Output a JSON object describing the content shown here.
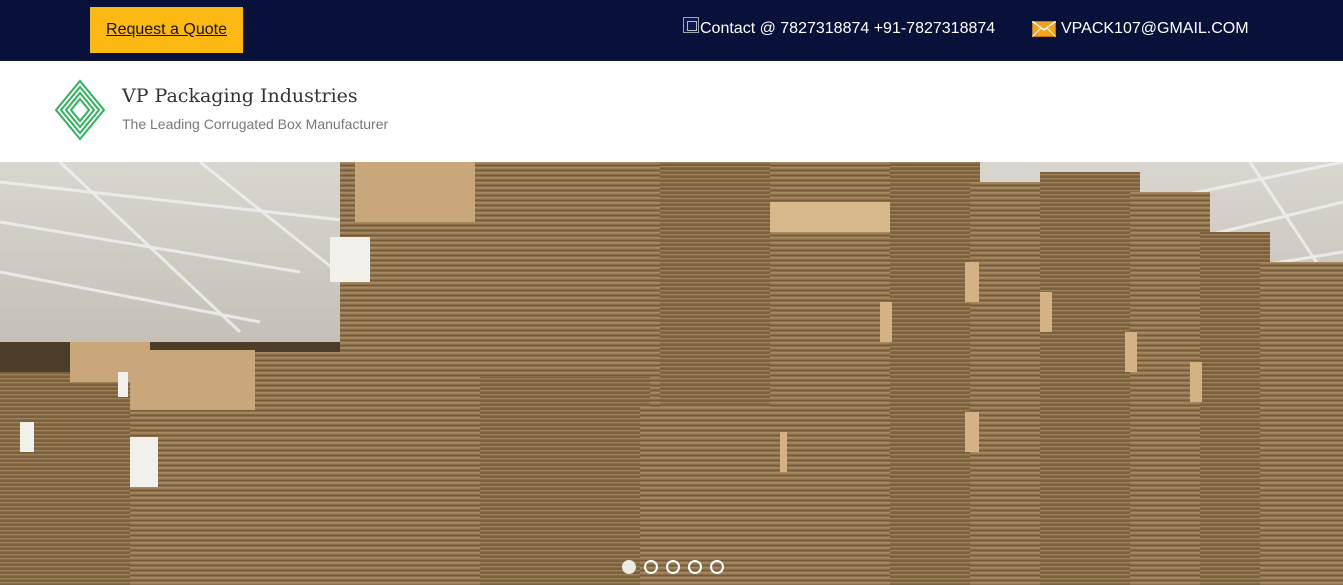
{
  "topbar": {
    "quote_label": "Request a Quote",
    "contact_text": "Contact @ 7827318874 +91-7827318874",
    "email_text": "VPACK107@GMAIL.COM",
    "contact_icon": "broken-image-icon",
    "email_icon": "mail-icon",
    "bg_color": "#07113a",
    "accent_color": "#fcb913"
  },
  "header": {
    "brand_name": "VP Packaging Industries",
    "tagline": "The Leading Corrugated Box Manufacturer",
    "logo_icon": "diamond-logo-icon",
    "logo_color": "#2fb25b"
  },
  "hero": {
    "image": "corrugated-sheet-stacks-photo",
    "slide_count": 5,
    "active_slide": 1
  }
}
